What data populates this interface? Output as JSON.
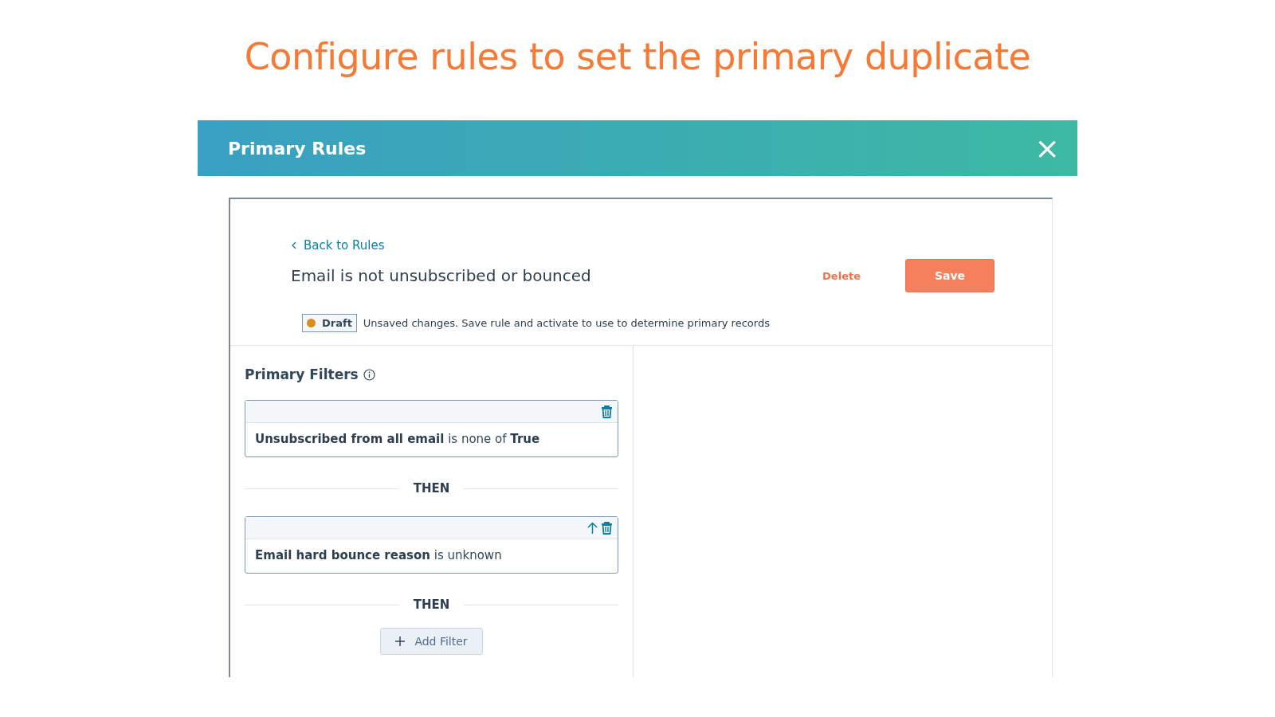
{
  "slide_title": "Configure rules to set the primary duplicate",
  "window": {
    "title": "Primary Rules",
    "close": "×"
  },
  "back_link": "Back to Rules",
  "rule_name": "Email is not unsubscribed or bounced",
  "buttons": [
    {
      "label": "Delete",
      "kind": "link"
    },
    {
      "label": "Save",
      "kind": "primary"
    }
  ],
  "status": {
    "badge": "Draft",
    "message": "Unsaved changes. Save rule and activate to use to determine primary records"
  },
  "filters_title": "Primary Filters",
  "filters": [
    {
      "text": "**Unsubscribed from all email** is none of **True**",
      "can_move_up": false,
      "separator": "THEN"
    },
    {
      "text": "**Email hard bounce reason** is unknown",
      "can_move_up": true,
      "separator": "THEN"
    }
  ],
  "add_filter": "Add Filter"
}
